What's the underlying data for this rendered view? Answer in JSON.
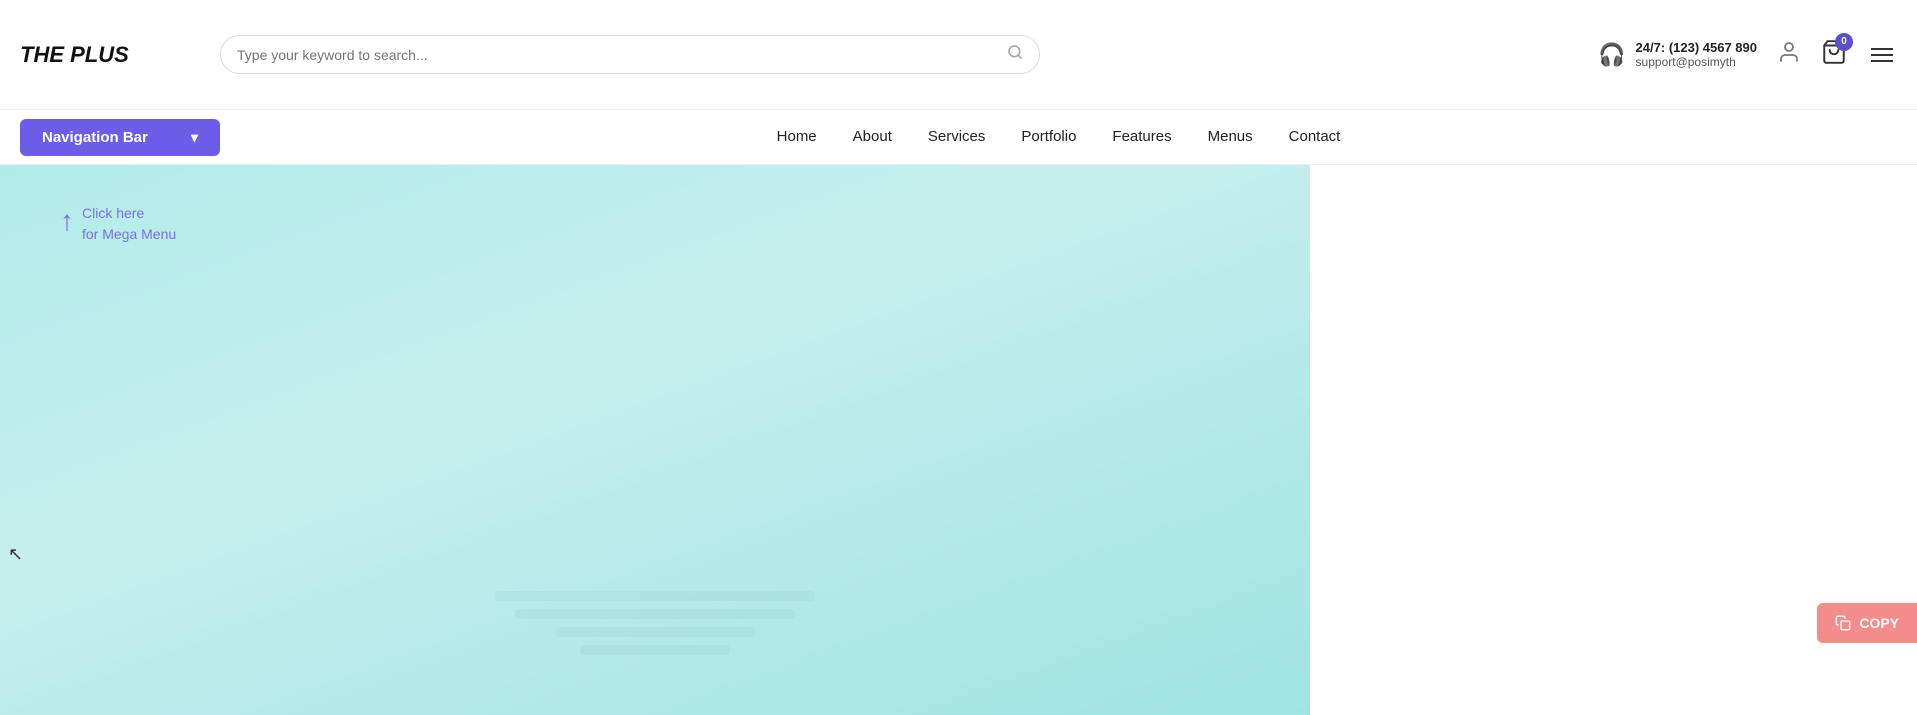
{
  "logo": {
    "text": "THE PLUS"
  },
  "search": {
    "placeholder": "Type your keyword to search..."
  },
  "support": {
    "label": "24/7:",
    "phone": "(123) 4567 890",
    "email": "support@posimyth"
  },
  "cart": {
    "badge": "0"
  },
  "navbar": {
    "dropdown_label": "Navigation Bar",
    "links": [
      {
        "label": "Home",
        "href": "#"
      },
      {
        "label": "About",
        "href": "#"
      },
      {
        "label": "Services",
        "href": "#"
      },
      {
        "label": "Portfolio",
        "href": "#"
      },
      {
        "label": "Features",
        "href": "#"
      },
      {
        "label": "Menus",
        "href": "#"
      },
      {
        "label": "Contact",
        "href": "#"
      }
    ]
  },
  "mega_menu_hint": {
    "line1": "Click here",
    "line2": "for Mega Menu"
  },
  "copy_button": {
    "label": "COPY"
  }
}
